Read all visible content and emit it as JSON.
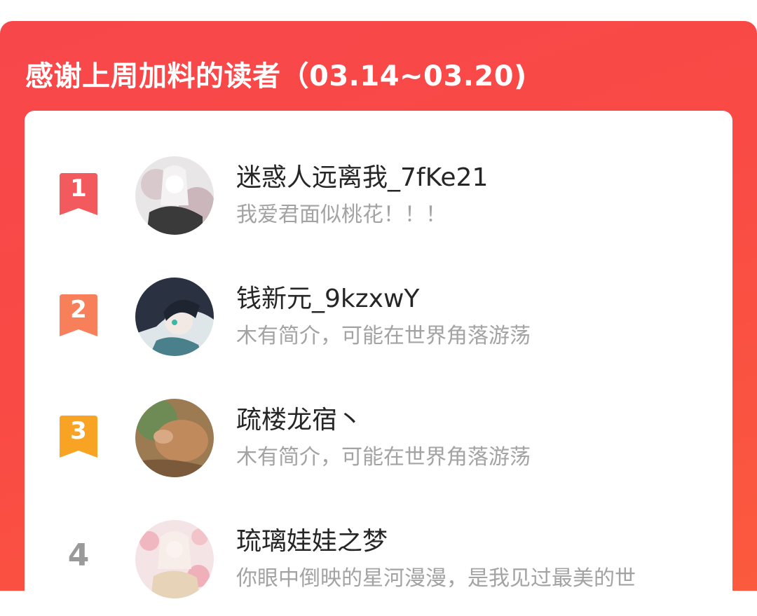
{
  "header": {
    "title": "感谢上周加料的读者（03.14~03.20)"
  },
  "colors": {
    "panel_red": "#f94a45",
    "rank1": "#f35a5e",
    "rank2": "#f77f5a",
    "rank3": "#f9a325",
    "rank_plain": "#9a9a9a"
  },
  "readers": [
    {
      "rank": "1",
      "name": "迷惑人远离我_7fKe21",
      "bio": "我爱君面似桃花！！！"
    },
    {
      "rank": "2",
      "name": "钱新元_9kzxwY",
      "bio": "木有简介，可能在世界角落游荡"
    },
    {
      "rank": "3",
      "name": "疏楼龙宿丶",
      "bio": "木有简介，可能在世界角落游荡"
    },
    {
      "rank": "4",
      "name": "琉璃娃娃之梦",
      "bio": "你眼中倒映的星河漫漫，是我见过最美的世"
    }
  ]
}
